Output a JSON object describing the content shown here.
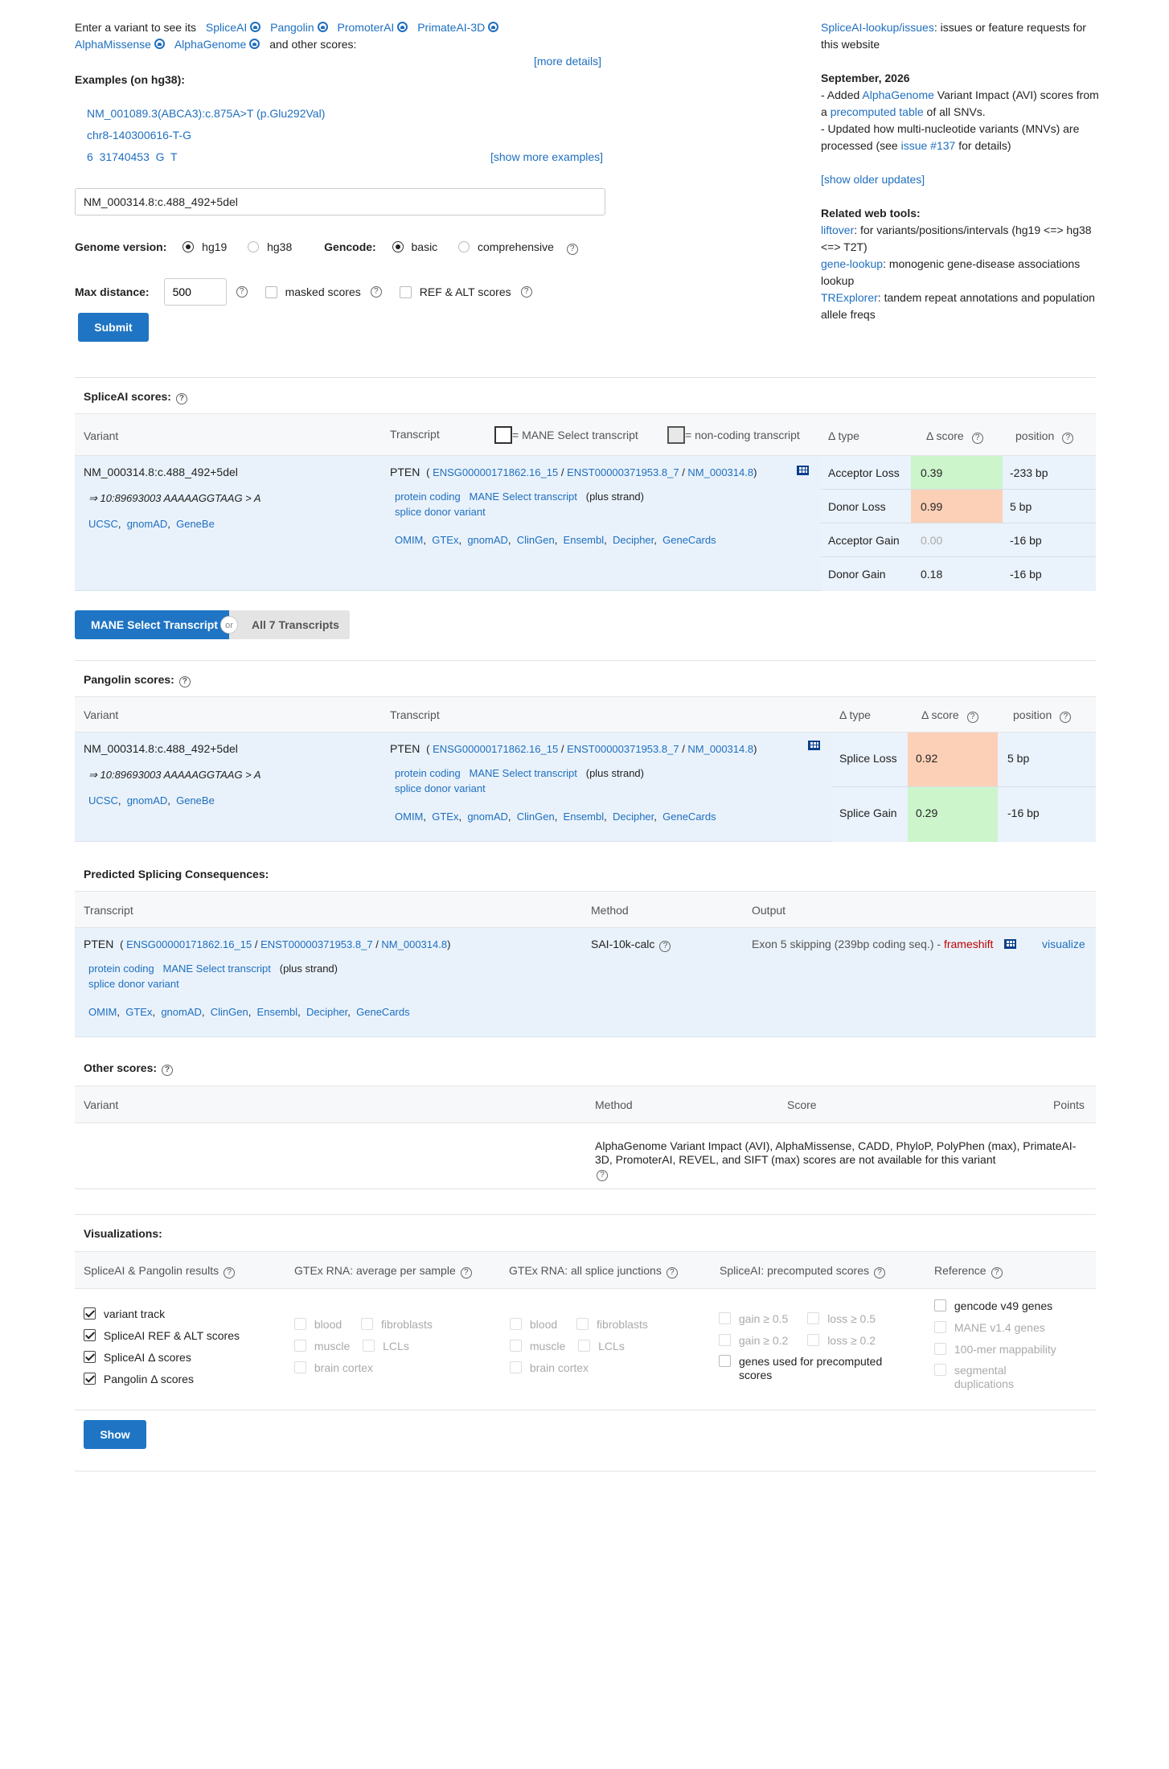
{
  "intro": {
    "prefix": "Enter a variant to see its",
    "tools": [
      "SpliceAI",
      "Pangolin",
      "PromoterAI",
      "PrimateAI-3D",
      "AlphaMissense",
      "AlphaGenome"
    ],
    "suffix": "and other scores:",
    "more_details": "[more details]"
  },
  "examples": {
    "title": "Examples  (on hg38):",
    "items": [
      "NM_001089.3(ABCA3):c.875A>T (p.Glu292Val)",
      "chr8-140300616-T-G",
      "6  31740453  G  T"
    ],
    "show_more": "[show more examples]"
  },
  "search": {
    "value": "NM_000314.8:c.488_492+5del"
  },
  "options": {
    "genome_label": "Genome version:",
    "hg19": "hg19",
    "hg38": "hg38",
    "gencode_label": "Gencode:",
    "basic": "basic",
    "comprehensive": "comprehensive",
    "maxdist_label": "Max distance:",
    "maxdist_value": "500",
    "masked": "masked scores",
    "refalt": "REF & ALT scores",
    "submit": "Submit"
  },
  "right": {
    "issues_link": "SpliceAI-lookup/issues",
    "issues_text": ": issues or feature requests for this website",
    "update_date": "September, 2026",
    "u1a": "- Added ",
    "u1link": "AlphaGenome",
    "u1b": " Variant Impact (AVI) scores from a ",
    "u1link2": "precomputed table",
    "u1c": " of all SNVs.",
    "u2a": "- Updated how multi-nucleotide variants (MNVs) are processed (see ",
    "u2link": "issue #137",
    "u2b": " for details)",
    "older": "[show older updates]",
    "related_title": "Related web tools:",
    "t1link": "liftover",
    "t1text": ": for variants/positions/intervals (hg19 <=> hg38 <=> T2T)",
    "t2link": "gene-lookup",
    "t2text": ": monogenic gene-disease associations lookup",
    "t3link": "TRExplorer",
    "t3text": ": tandem repeat annotations and population allele freqs"
  },
  "spliceai": {
    "title": "SpliceAI scores:",
    "h_variant": "Variant",
    "h_transcript": "Transcript",
    "legend_mane": "= MANE Select transcript",
    "legend_noncoding": "= non-coding transcript",
    "h_type": "Δ type",
    "h_score": "Δ score",
    "h_position": "position",
    "variant": "NM_000314.8:c.488_492+5del",
    "variant_hg": "⇒ 10:89693003 AAAAAGGTAAG > A",
    "vlinks": [
      "UCSC",
      "gnomAD",
      "GeneBe"
    ],
    "gene": "PTEN",
    "ens_gene": "ENSG00000171862.16_15",
    "ens_tx": "ENST00000371953.8_7",
    "refseq": "NM_000314.8",
    "tags": [
      "protein coding",
      "MANE Select transcript"
    ],
    "strand": "(plus strand)",
    "consequence": "splice donor variant",
    "db_links": [
      "OMIM",
      "GTEx",
      "gnomAD",
      "ClinGen",
      "Ensembl",
      "Decipher",
      "GeneCards"
    ],
    "rows": [
      {
        "type": "Acceptor Loss",
        "score": "0.39",
        "pos": "-233 bp",
        "bg": "#ccf5cc"
      },
      {
        "type": "Donor Loss",
        "score": "0.99",
        "pos": "5 bp",
        "bg": "#fbd0b6"
      },
      {
        "type": "Acceptor Gain",
        "score": "0.00",
        "pos": "-16 bp",
        "bg": ""
      },
      {
        "type": "Donor Gain",
        "score": "0.18",
        "pos": "-16 bp",
        "bg": ""
      }
    ]
  },
  "toggle": {
    "mane": "MANE Select Transcript",
    "or": "or",
    "all": "All 7 Transcripts"
  },
  "pangolin": {
    "title": "Pangolin scores:",
    "rows": [
      {
        "type": "Splice Loss",
        "score": "0.92",
        "pos": "5 bp",
        "bg": "#fbd0b6"
      },
      {
        "type": "Splice Gain",
        "score": "0.29",
        "pos": "-16 bp",
        "bg": "#ccf5cc"
      }
    ]
  },
  "consequences": {
    "title": "Predicted Splicing Consequences:",
    "h_transcript": "Transcript",
    "h_method": "Method",
    "h_output": "Output",
    "method": "SAI-10k-calc",
    "output_text": "Exon 5 skipping (239bp coding seq.) -",
    "output_effect": "frameshift",
    "visualize": "visualize"
  },
  "other": {
    "title": "Other scores:",
    "h_variant": "Variant",
    "h_method": "Method",
    "h_score": "Score",
    "h_points": "Points",
    "message": "AlphaGenome Variant Impact (AVI),  AlphaMissense,  CADD,  PhyloP,  PolyPhen (max),  PrimateAI-3D,  PromoterAI,  REVEL,  and SIFT (max) scores are not available for this variant"
  },
  "viz": {
    "title": "Visualizations:",
    "c1": {
      "head": "SpliceAI & Pangolin results",
      "items": [
        "variant track",
        "SpliceAI REF & ALT scores",
        "SpliceAI Δ  scores",
        "Pangolin Δ  scores"
      ]
    },
    "c2": {
      "head": "GTEx RNA: average per sample",
      "items": [
        "blood",
        "fibroblasts",
        "muscle",
        "LCLs",
        "brain cortex"
      ]
    },
    "c3": {
      "head": "GTEx RNA: all splice junctions",
      "items": [
        "blood",
        "fibroblasts",
        "muscle",
        "LCLs",
        "brain cortex"
      ]
    },
    "c4": {
      "head": "SpliceAI: precomputed scores",
      "items": [
        "gain ≥ 0.5",
        "loss ≥ 0.5",
        "gain ≥ 0.2",
        "loss ≥ 0.2",
        "genes used for precomputed scores"
      ]
    },
    "c5": {
      "head": "Reference",
      "items": [
        "gencode v49 genes",
        "MANE v1.4 genes",
        "100-mer mappability",
        "segmental duplications"
      ]
    },
    "show": "Show"
  },
  "colors": {
    "link": "#1f6fbf",
    "button": "#1f75c4",
    "row_bg": "#e9f2fb",
    "high": "#fbd0b6",
    "low": "#ccf5cc",
    "frameshift": "#c00000"
  }
}
